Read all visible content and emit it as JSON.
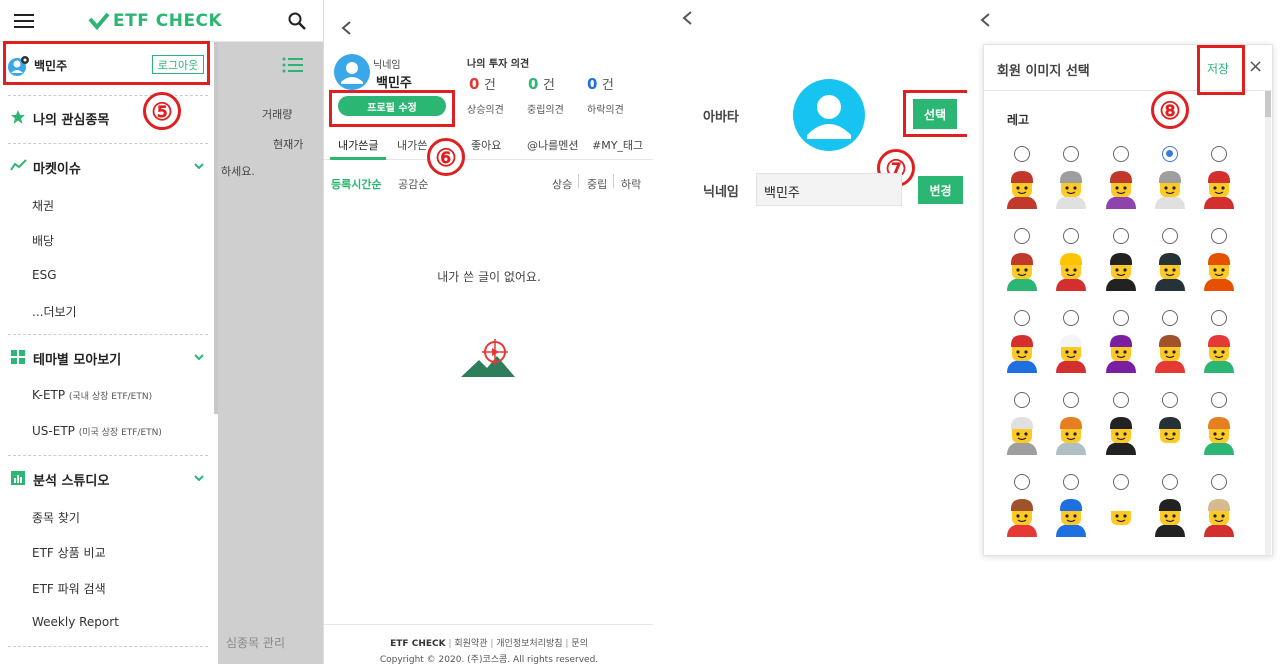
{
  "panel1": {
    "logo": "ETF CHECK",
    "user_name": "백민주",
    "logout_label": "로그아웃",
    "step_number": "⑤",
    "menu": {
      "watchlist": "나의 관심종목",
      "market_issue": "마켓이슈",
      "market_items": [
        "채권",
        "배당",
        "ESG",
        "...더보기"
      ],
      "theme": "테마별 모아보기",
      "theme_items": [
        {
          "label": "K-ETP",
          "sub": "(국내 상장 ETF/ETN)"
        },
        {
          "label": "US-ETP",
          "sub": "(미국 상장 ETF/ETN)"
        }
      ],
      "studio": "분석 스튜디오",
      "studio_items": [
        "종목 찾기",
        "ETF 상품 비교",
        "ETF 파워 검색",
        "Weekly Report"
      ]
    },
    "background": {
      "volume_label": "거래량",
      "price_label": "현재가",
      "partial_text": "하세요.",
      "bottom_text": "심종목 관리"
    },
    "colors": {
      "accent": "#2bb673",
      "overlay": "#cfcfcf"
    }
  },
  "panel2": {
    "nickname_label": "닉네임",
    "nickname": "백민주",
    "opinion_title": "나의 투자 의견",
    "counts": [
      {
        "value": "0",
        "unit": "건",
        "label": "상승의견",
        "color": "#e53935"
      },
      {
        "value": "0",
        "unit": "건",
        "label": "중립의견",
        "color": "#2bb673"
      },
      {
        "value": "0",
        "unit": "건",
        "label": "하락의견",
        "color": "#1e6fe0"
      }
    ],
    "edit_profile_label": "프로필 수정",
    "step_number": "⑥",
    "tabs": [
      "내가쓴글",
      "내가쓴댓글",
      "좋아요",
      "@나를멘션",
      "#MY_태그"
    ],
    "tab2_visible": "내가쓴",
    "sort": {
      "recent": "등록시간순",
      "empathy": "공감순"
    },
    "filters": [
      "상승",
      "중립",
      "하락"
    ],
    "empty_message": "내가 쓴 글이 없어요.",
    "footer_links": [
      "ETF CHECK",
      "회원약관",
      "개인정보처리방침",
      "문의"
    ],
    "copyright": "Copyright © 2020. (주)코스콤. All rights reserved."
  },
  "panel3": {
    "avatar_label": "아바타",
    "select_label": "선택",
    "nickname_label": "닉네임",
    "nickname_value": "백민주",
    "change_label": "변경",
    "step_number": "⑦"
  },
  "panel4": {
    "modal_title": "회원 이미지 선택",
    "save_label": "저장",
    "close_glyph": "×",
    "category": "레고",
    "step_number": "⑧",
    "selected_index": 3,
    "rows": [
      [
        {
          "name": "brown-hair-man",
          "hair": "#c0392b",
          "shirt": "#c0392b"
        },
        {
          "name": "gray-bald-man",
          "hair": "#9e9e9e",
          "shirt": "#e0e0e0"
        },
        {
          "name": "pigtail-girl",
          "hair": "#c0392b",
          "shirt": "#8e44ad"
        },
        {
          "name": "old-man-glasses",
          "hair": "#9e9e9e",
          "shirt": "#e0e0e0"
        },
        {
          "name": "red-hair-woman",
          "hair": "#d32f2f",
          "shirt": "#d32f2f"
        }
      ],
      [
        {
          "name": "sombrero-man",
          "hair": "#c0392b",
          "shirt": "#2bb673"
        },
        {
          "name": "bald-man",
          "hair": "#ffc400",
          "shirt": "#d32f2f"
        },
        {
          "name": "pirate",
          "hair": "#222222",
          "shirt": "#222222"
        },
        {
          "name": "police-officer",
          "hair": "#263238",
          "shirt": "#263238"
        },
        {
          "name": "firefighter",
          "hair": "#e65100",
          "shirt": "#e65100"
        }
      ],
      [
        {
          "name": "cap-man",
          "hair": "#d32f2f",
          "shirt": "#1e6fe0"
        },
        {
          "name": "astronaut",
          "hair": "#f5f5f5",
          "shirt": "#d32f2f"
        },
        {
          "name": "purple-hair-woman",
          "hair": "#7b1fa2",
          "shirt": "#7b1fa2"
        },
        {
          "name": "curly-man",
          "hair": "#a0522d",
          "shirt": "#e53935"
        },
        {
          "name": "goggles-man",
          "hair": "#e53935",
          "shirt": "#2bb673"
        }
      ],
      [
        {
          "name": "skeleton",
          "hair": "#e0e0e0",
          "shirt": "#9e9e9e"
        },
        {
          "name": "orange-hair-woman",
          "hair": "#e67e22",
          "shirt": "#b0bec5"
        },
        {
          "name": "sunglasses-man",
          "hair": "#222222",
          "shirt": "#222222"
        },
        {
          "name": "beret-man",
          "hair": "#263238",
          "shirt": "#ffffff"
        },
        {
          "name": "orange-beanie-man",
          "hair": "#e67e22",
          "shirt": "#2bb673"
        }
      ],
      [
        {
          "name": "woman-red-shirt",
          "hair": "#a0522d",
          "shirt": "#e53935"
        },
        {
          "name": "cap-mustache-man",
          "hair": "#1e6fe0",
          "shirt": "#1e6fe0"
        },
        {
          "name": "chef",
          "hair": "#ffffff",
          "shirt": "#ffffff"
        },
        {
          "name": "black-hair-woman",
          "hair": "#222222",
          "shirt": "#222222"
        },
        {
          "name": "wizard",
          "hair": "#d7b98e",
          "shirt": "#d32f2f"
        }
      ]
    ]
  }
}
